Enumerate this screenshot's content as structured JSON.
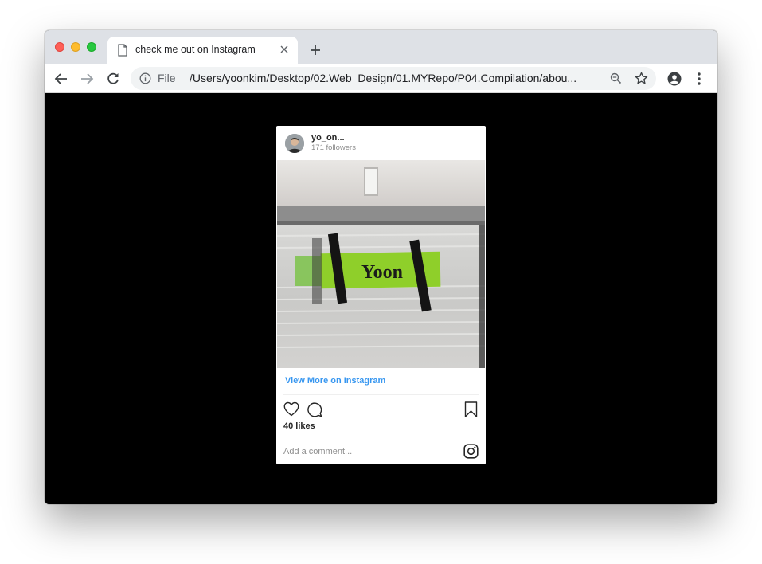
{
  "browser": {
    "tab": {
      "title": "check me out on Instagram"
    },
    "address_bar": {
      "scheme_label": "File",
      "url": "/Users/yoonkim/Desktop/02.Web_Design/01.MYRepo/P04.Compilation/abou..."
    }
  },
  "instagram_embed": {
    "username": "yo_on...",
    "followers": "171 followers",
    "photo_sign_text": "Yoon",
    "view_more": "View More on Instagram",
    "likes": "40 likes",
    "comment_placeholder": "Add a comment...",
    "colors": {
      "link": "#3897f0",
      "sign": "#8fcf2a"
    }
  }
}
